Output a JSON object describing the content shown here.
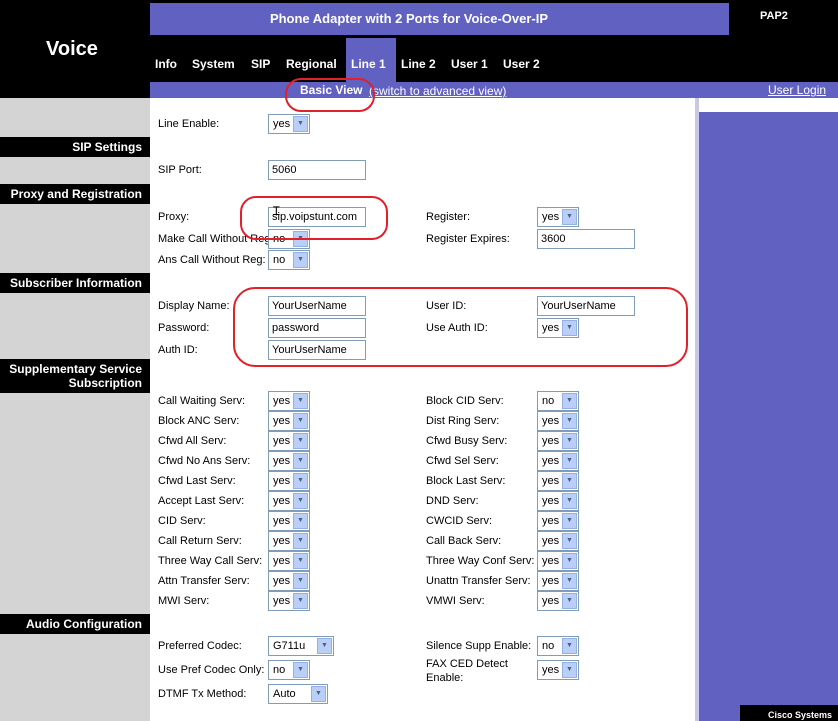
{
  "header": {
    "brand": "Voice",
    "title": "Phone Adapter with 2 Ports for Voice-Over-IP",
    "model": "PAP2"
  },
  "nav": {
    "tabs": [
      {
        "label": "Info"
      },
      {
        "label": "System"
      },
      {
        "label": "SIP"
      },
      {
        "label": "Regional"
      },
      {
        "label": "Line 1"
      },
      {
        "label": "Line 2"
      },
      {
        "label": "User 1"
      },
      {
        "label": "User 2"
      }
    ],
    "active_tab": "Line 1"
  },
  "subnav": {
    "basic_view": "Basic View",
    "advanced_link": "(switch to advanced view)",
    "user_login": "User Login"
  },
  "sections": {
    "sip_settings": "SIP Settings",
    "proxy_registration": "Proxy and Registration",
    "subscriber_info": "Subscriber Information",
    "supplementary_line1": "Supplementary Service",
    "supplementary_line2": "Subscription",
    "audio_config": "Audio Configuration"
  },
  "fields": {
    "line_enable": {
      "label": "Line Enable:",
      "value": "yes"
    },
    "sip_port": {
      "label": "SIP Port:",
      "value": "5060"
    },
    "proxy": {
      "label": "Proxy:",
      "value": "sip.voipstunt.com"
    },
    "register": {
      "label": "Register:",
      "value": "yes"
    },
    "make_call_without_reg": {
      "label": "Make Call Without Reg:",
      "value": "no"
    },
    "register_expires": {
      "label": "Register Expires:",
      "value": "3600"
    },
    "ans_call_without_reg": {
      "label": "Ans Call Without Reg:",
      "value": "no"
    },
    "display_name": {
      "label": "Display Name:",
      "value": "YourUserName"
    },
    "user_id": {
      "label": "User ID:",
      "value": "YourUserName"
    },
    "password": {
      "label": "Password:",
      "value": "password"
    },
    "use_auth_id": {
      "label": "Use Auth ID:",
      "value": "yes"
    },
    "auth_id": {
      "label": "Auth ID:",
      "value": "YourUserName"
    },
    "preferred_codec": {
      "label": "Preferred Codec:",
      "value": "G711u"
    },
    "silence_supp_enable": {
      "label": "Silence Supp Enable:",
      "value": "no"
    },
    "use_pref_codec_only": {
      "label": "Use Pref Codec Only:",
      "value": "no"
    },
    "fax_ced_detect_line1": "FAX CED Detect",
    "fax_ced_detect_line2": "Enable:",
    "fax_ced_detect_value": "yes",
    "dtmf_tx_method": {
      "label": "DTMF Tx Method:",
      "value": "Auto"
    }
  },
  "supplementary_left": [
    {
      "label": "Call Waiting Serv:",
      "value": "yes"
    },
    {
      "label": "Block ANC Serv:",
      "value": "yes"
    },
    {
      "label": "Cfwd All Serv:",
      "value": "yes"
    },
    {
      "label": "Cfwd No Ans Serv:",
      "value": "yes"
    },
    {
      "label": "Cfwd Last Serv:",
      "value": "yes"
    },
    {
      "label": "Accept Last Serv:",
      "value": "yes"
    },
    {
      "label": "CID Serv:",
      "value": "yes"
    },
    {
      "label": "Call Return Serv:",
      "value": "yes"
    },
    {
      "label": "Three Way Call Serv:",
      "value": "yes"
    },
    {
      "label": "Attn Transfer Serv:",
      "value": "yes"
    },
    {
      "label": "MWI Serv:",
      "value": "yes"
    }
  ],
  "supplementary_right": [
    {
      "label": "Block CID Serv:",
      "value": "no"
    },
    {
      "label": "Dist Ring Serv:",
      "value": "yes"
    },
    {
      "label": "Cfwd Busy Serv:",
      "value": "yes"
    },
    {
      "label": "Cfwd Sel Serv:",
      "value": "yes"
    },
    {
      "label": "Block Last Serv:",
      "value": "yes"
    },
    {
      "label": "DND Serv:",
      "value": "yes"
    },
    {
      "label": "CWCID Serv:",
      "value": "yes"
    },
    {
      "label": "Call Back Serv:",
      "value": "yes"
    },
    {
      "label": "Three Way Conf Serv:",
      "value": "yes"
    },
    {
      "label": "Unattn Transfer Serv:",
      "value": "yes"
    },
    {
      "label": "VMWI Serv:",
      "value": "yes"
    }
  ],
  "footer": {
    "vendor": "Cisco Systems"
  },
  "colors": {
    "accent": "#6161c1",
    "annotation": "#e1202a"
  }
}
